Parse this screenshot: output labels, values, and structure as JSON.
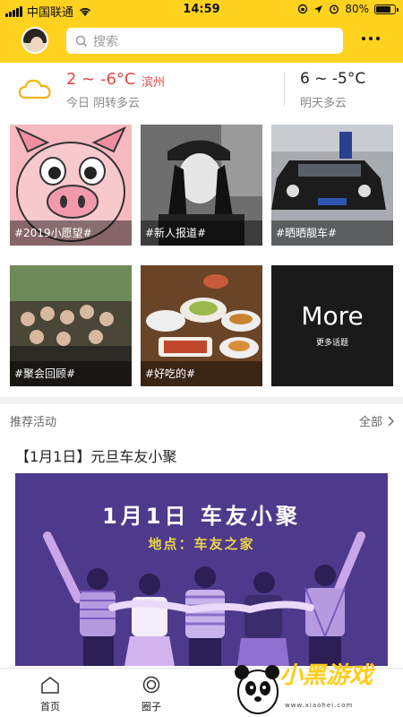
{
  "status_bar": {
    "carrier": "中国联通",
    "time": "14:59",
    "battery_percent": "80%",
    "battery_level": 0.8
  },
  "header": {
    "search_placeholder": "搜索"
  },
  "weather": {
    "today_temp": "2 ~ -6°C",
    "city": "滨州",
    "today_desc": "今日 阴转多云",
    "tomorrow_temp": "6 ~ -5°C",
    "tomorrow_desc": "明天多云"
  },
  "topics": [
    {
      "caption": "#2019小愿望#"
    },
    {
      "caption": "#新人报道#"
    },
    {
      "caption": "#晒晒靓车#"
    },
    {
      "caption": "#聚会回顾#"
    },
    {
      "caption": "#好吃的#"
    }
  ],
  "more_tile": {
    "title": "More",
    "subtitle": "更多话题"
  },
  "recommend": {
    "section_title": "推荐活动",
    "all_label": "全部"
  },
  "event": {
    "title": "【1月1日】元旦车友小聚",
    "banner_title": "1月1日  车友小聚",
    "banner_subtitle": "地点：车友之家"
  },
  "tabs": [
    {
      "label": "首页"
    },
    {
      "label": "圈子"
    }
  ],
  "watermark": {
    "text": "小黑游戏",
    "url": "www.xiaohei.com"
  },
  "colors": {
    "brand_yellow": "#ffd21f",
    "temp_red": "#e84545",
    "banner_purple": "#4e3a8c"
  }
}
